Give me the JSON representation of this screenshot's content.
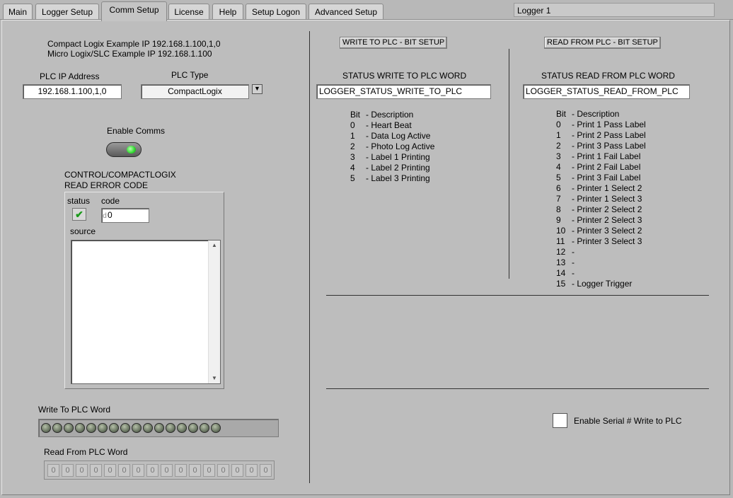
{
  "tabs": [
    "Main",
    "Logger Setup",
    "Comm Setup",
    "License",
    "Help",
    "Setup Logon",
    "Advanced Setup"
  ],
  "logger_name": "Logger 1",
  "left": {
    "example_compact": "Compact Logix Example IP 192.168.1.100,1,0",
    "example_micro": "Micro Logix/SLC Example IP 192.168.1.100",
    "plc_ip_label": "PLC IP Address",
    "plc_ip_value": "192.168.1.100,1,0",
    "plc_type_label": "PLC Type",
    "plc_type_value": "CompactLogix",
    "enable_comms_label": "Enable Comms",
    "error_title_line1": "CONTROL/COMPACTLOGIX",
    "error_title_line2": "READ ERROR CODE",
    "status_label": "status",
    "code_label": "code",
    "code_prefix": "d",
    "code_value": "0",
    "source_label": "source",
    "write_word_label": "Write To PLC Word",
    "read_word_label": "Read From PLC Word",
    "read_word_values": [
      "0",
      "0",
      "0",
      "0",
      "0",
      "0",
      "0",
      "0",
      "0",
      "0",
      "0",
      "0",
      "0",
      "0",
      "0",
      "0"
    ]
  },
  "write": {
    "button": "WRITE TO PLC - BIT SETUP",
    "status_label": "STATUS WRITE TO PLC WORD",
    "status_value": "LOGGER_STATUS_WRITE_TO_PLC",
    "header_bit": "Bit",
    "header_desc": "- Description",
    "bits": [
      {
        "n": "0",
        "d": "- Heart Beat"
      },
      {
        "n": "1",
        "d": "- Data Log Active"
      },
      {
        "n": "2",
        "d": "- Photo Log Active"
      },
      {
        "n": "3",
        "d": "- Label 1 Printing"
      },
      {
        "n": "4",
        "d": "- Label 2 Printing"
      },
      {
        "n": "5",
        "d": "- Label 3 Printing"
      }
    ]
  },
  "read": {
    "button": "READ FROM PLC - BIT SETUP",
    "status_label": "STATUS READ FROM PLC WORD",
    "status_value": "LOGGER_STATUS_READ_FROM_PLC",
    "header_bit": "Bit",
    "header_desc": "- Description",
    "bits": [
      {
        "n": "0",
        "d": "- Print 1 Pass Label"
      },
      {
        "n": "1",
        "d": "- Print 2 Pass Label"
      },
      {
        "n": "2",
        "d": "- Print 3 Pass Label"
      },
      {
        "n": "3",
        "d": "- Print 1 Fail Label"
      },
      {
        "n": "4",
        "d": "- Print 2 Fail Label"
      },
      {
        "n": "5",
        "d": "- Print 3 Fail Label"
      },
      {
        "n": "6",
        "d": "- Printer 1 Select 2"
      },
      {
        "n": "7",
        "d": "- Printer 1 Select 3"
      },
      {
        "n": "8",
        "d": "- Printer 2 Select 2"
      },
      {
        "n": "9",
        "d": "- Printer 2 Select 3"
      },
      {
        "n": "10",
        "d": "- Printer 3 Select 2"
      },
      {
        "n": "11",
        "d": "- Printer 3 Select 3"
      },
      {
        "n": "12",
        "d": "-"
      },
      {
        "n": "13",
        "d": "-"
      },
      {
        "n": "14",
        "d": "-"
      },
      {
        "n": "15",
        "d": "- Logger Trigger"
      }
    ]
  },
  "serial_label": "Enable Serial # Write to PLC",
  "colors": {
    "background": "#bdbdbd",
    "led_green": "#2fd82f",
    "check_green": "#1a9a1a"
  }
}
